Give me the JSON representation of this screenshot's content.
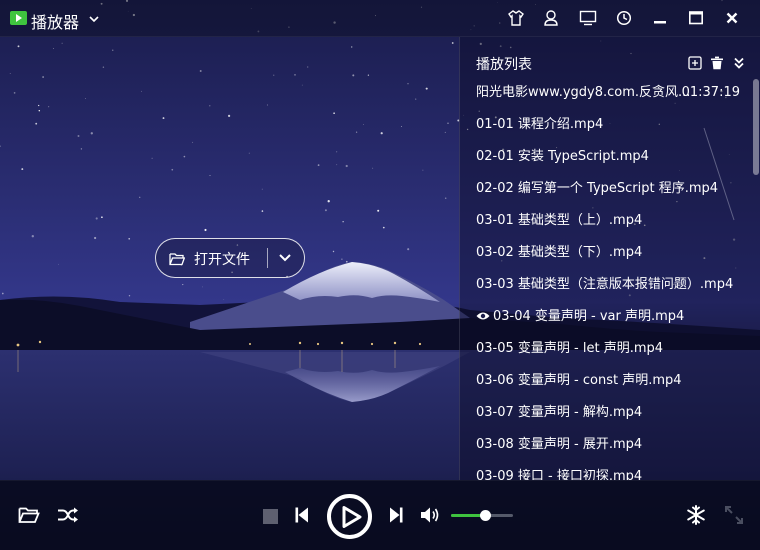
{
  "app": {
    "title": "播放器",
    "accent_color": "#3fc43f"
  },
  "titlebar_icons": [
    "skin-icon",
    "user-icon",
    "screen-icon",
    "history-icon",
    "minimize-icon",
    "maximize-icon",
    "close-icon"
  ],
  "open_button": {
    "label": "打开文件"
  },
  "playlist": {
    "title": "播放列表",
    "actions": [
      "add-icon",
      "trash-icon",
      "collapse-icon"
    ],
    "items": [
      {
        "name": "阳光电影www.ygdy8.com.反贪风...",
        "duration": "01:37:19",
        "playing": false
      },
      {
        "name": "01-01 课程介绍.mp4",
        "playing": false
      },
      {
        "name": "02-01 安装 TypeScript.mp4",
        "playing": false
      },
      {
        "name": "02-02 编写第一个 TypeScript 程序.mp4",
        "playing": false
      },
      {
        "name": "03-01 基础类型（上）.mp4",
        "playing": false
      },
      {
        "name": "03-02 基础类型（下）.mp4",
        "playing": false
      },
      {
        "name": "03-03 基础类型（注意版本报错问题）.mp4",
        "playing": false
      },
      {
        "name": "03-04 变量声明 - var 声明.mp4",
        "playing": true
      },
      {
        "name": "03-05 变量声明 - let 声明.mp4",
        "playing": false
      },
      {
        "name": "03-06 变量声明 - const 声明.mp4",
        "playing": false
      },
      {
        "name": "03-07 变量声明 - 解构.mp4",
        "playing": false
      },
      {
        "name": "03-08 变量声明 - 展开.mp4",
        "playing": false
      },
      {
        "name": "03-09 接口 - 接口初探.mp4",
        "playing": false
      }
    ]
  },
  "controls": {
    "volume_level": 0.55
  }
}
